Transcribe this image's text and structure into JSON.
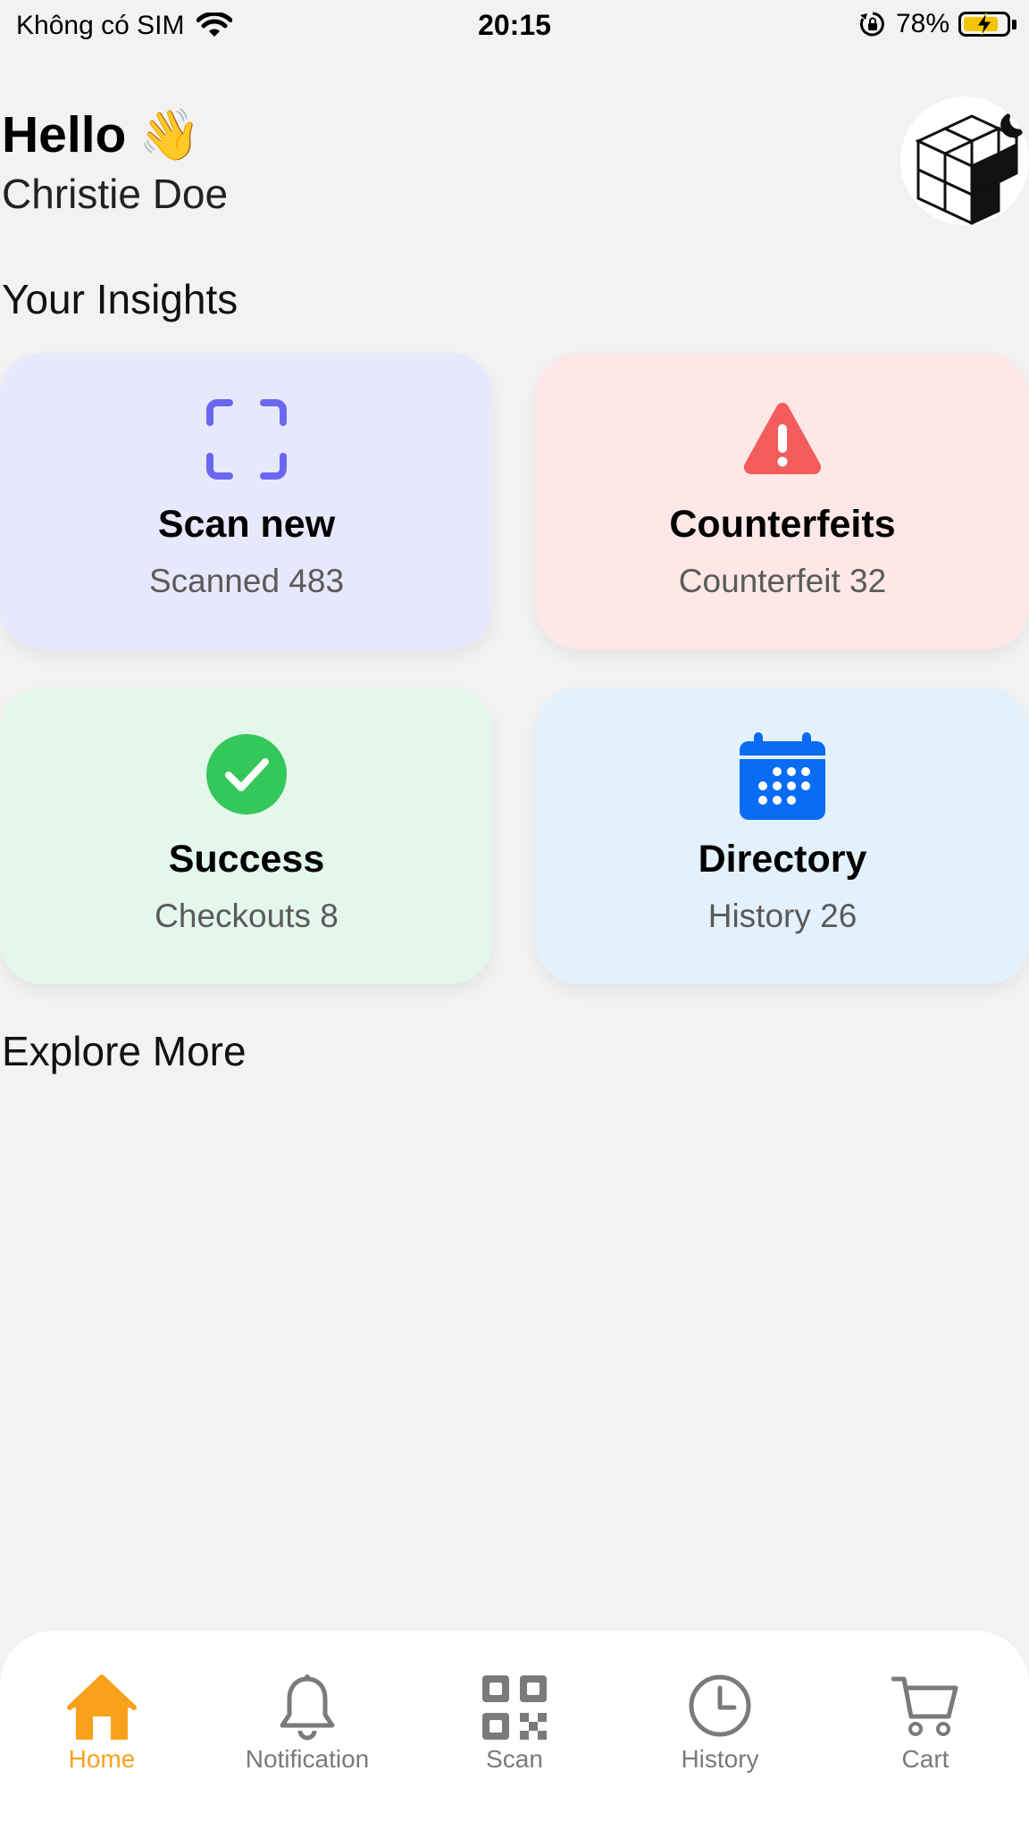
{
  "status_bar": {
    "carrier": "Không có SIM",
    "time": "20:15",
    "battery_percent": "78%",
    "battery_level": 0.78
  },
  "header": {
    "greeting": "Hello",
    "greeting_emoji": "👋",
    "user_name": "Christie Doe"
  },
  "insights": {
    "title": "Your Insights",
    "cards": [
      {
        "title": "Scan new",
        "subtitle": "Scanned 483",
        "icon": "scan-frame-icon",
        "bg": "#e8e8fc",
        "icon_color": "#6b66f0"
      },
      {
        "title": "Counterfeits",
        "subtitle": "Counterfeit 32",
        "icon": "warning-icon",
        "bg": "#fde7e7",
        "icon_color": "#f25c5c"
      },
      {
        "title": "Success",
        "subtitle": "Checkouts 8",
        "icon": "check-circle-icon",
        "bg": "#e3f7ec",
        "icon_color": "#34c759"
      },
      {
        "title": "Directory",
        "subtitle": "History 26",
        "icon": "calendar-icon",
        "bg": "#e3f1fd",
        "icon_color": "#0a6cf5"
      }
    ]
  },
  "explore": {
    "title": "Explore More"
  },
  "bottom_nav": {
    "active_color": "#f9a11b",
    "inactive_color": "#7a7a7a",
    "items": [
      {
        "label": "Home",
        "icon": "home-icon",
        "active": true
      },
      {
        "label": "Notification",
        "icon": "bell-icon",
        "active": false
      },
      {
        "label": "Scan",
        "icon": "qr-code-icon",
        "active": false
      },
      {
        "label": "History",
        "icon": "clock-icon",
        "active": false
      },
      {
        "label": "Cart",
        "icon": "cart-icon",
        "active": false
      }
    ]
  }
}
